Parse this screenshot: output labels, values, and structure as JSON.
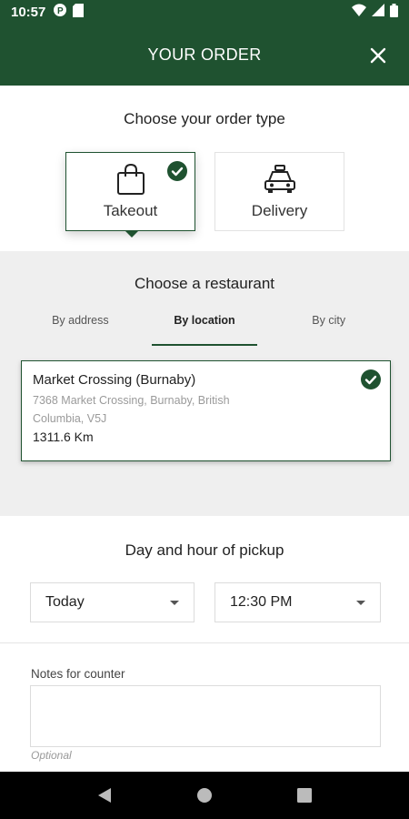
{
  "status_bar": {
    "time": "10:57"
  },
  "header": {
    "title": "YOUR ORDER"
  },
  "order_type": {
    "heading": "Choose your order type",
    "options": [
      {
        "label": "Takeout",
        "icon": "shopping-bag-icon",
        "selected": true
      },
      {
        "label": "Delivery",
        "icon": "car-icon",
        "selected": false
      }
    ]
  },
  "restaurant": {
    "heading": "Choose a restaurant",
    "tabs": [
      {
        "label": "By address",
        "active": false
      },
      {
        "label": "By location",
        "active": true
      },
      {
        "label": "By city",
        "active": false
      }
    ],
    "selected": {
      "name": "Market Crossing (Burnaby)",
      "address": "7368 Market Crossing, Burnaby, British Columbia, V5J",
      "distance": "1311.6 Km"
    }
  },
  "pickup": {
    "heading": "Day and hour of pickup",
    "day": "Today",
    "time": "12:30 PM"
  },
  "notes": {
    "label": "Notes for counter",
    "value": "",
    "hint": "Optional"
  },
  "colors": {
    "brand_green": "#1f5230",
    "section_gray": "#efefef"
  }
}
